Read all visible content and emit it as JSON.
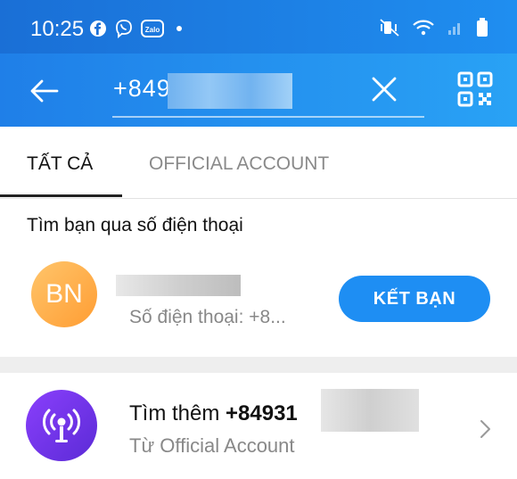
{
  "status_bar": {
    "time": "10:25",
    "zalo_label": "Zalo",
    "icons": [
      "facebook-icon",
      "viber-icon",
      "zalo-icon",
      "mute-vibrate-icon",
      "wifi-icon",
      "signal-icon",
      "battery-icon"
    ]
  },
  "search": {
    "query": "+849"
  },
  "tabs": [
    {
      "label": "TẤT CẢ",
      "active": true
    },
    {
      "label": "OFFICIAL ACCOUNT",
      "active": false
    }
  ],
  "phone_result": {
    "section_title": "Tìm bạn qua số điện thoại",
    "avatar_initials": "BN",
    "subtitle": "Số điện thoại: +8...",
    "button_label": "KẾT BẠN"
  },
  "official_account": {
    "prefix": "Tìm thêm ",
    "query": "+84931",
    "subtitle": "Từ Official Account"
  },
  "colors": {
    "header_blue": "#1f8ef0",
    "button_blue": "#1e8ef3",
    "avatar_orange": "#ffb04d",
    "oa_purple": "#7a36f0"
  }
}
